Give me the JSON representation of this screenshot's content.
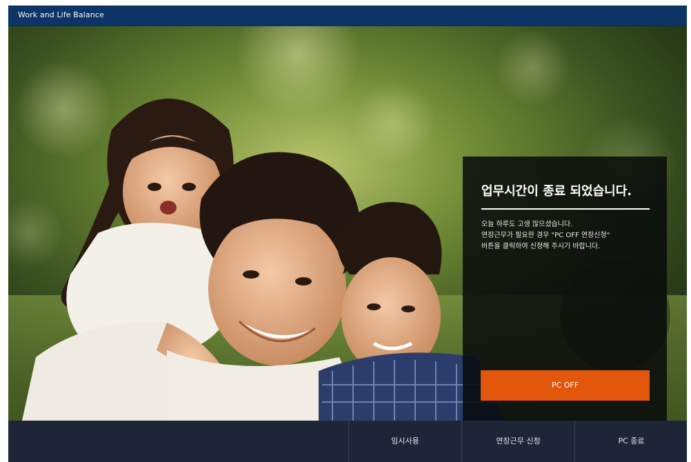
{
  "window": {
    "title": "Work and Life Balance"
  },
  "message": {
    "title": "업무시간이 종료 되었습니다.",
    "lines": [
      "오늘 하루도 고생 많으셨습니다.",
      "연장근무가 필요한 경우 \"PC OFF 연장신청\"",
      "버튼을 클릭하여 신청해 주시기 바랍니다."
    ],
    "button_label": "PC OFF"
  },
  "footer": {
    "buttons": [
      {
        "label": "임시사용"
      },
      {
        "label": "연장근무 신청"
      },
      {
        "label": "PC 종료"
      }
    ]
  },
  "colors": {
    "titlebar": "#0d3466",
    "accent_button": "#e3570d",
    "footer": "#1e2536",
    "panel": "#080a0c"
  }
}
